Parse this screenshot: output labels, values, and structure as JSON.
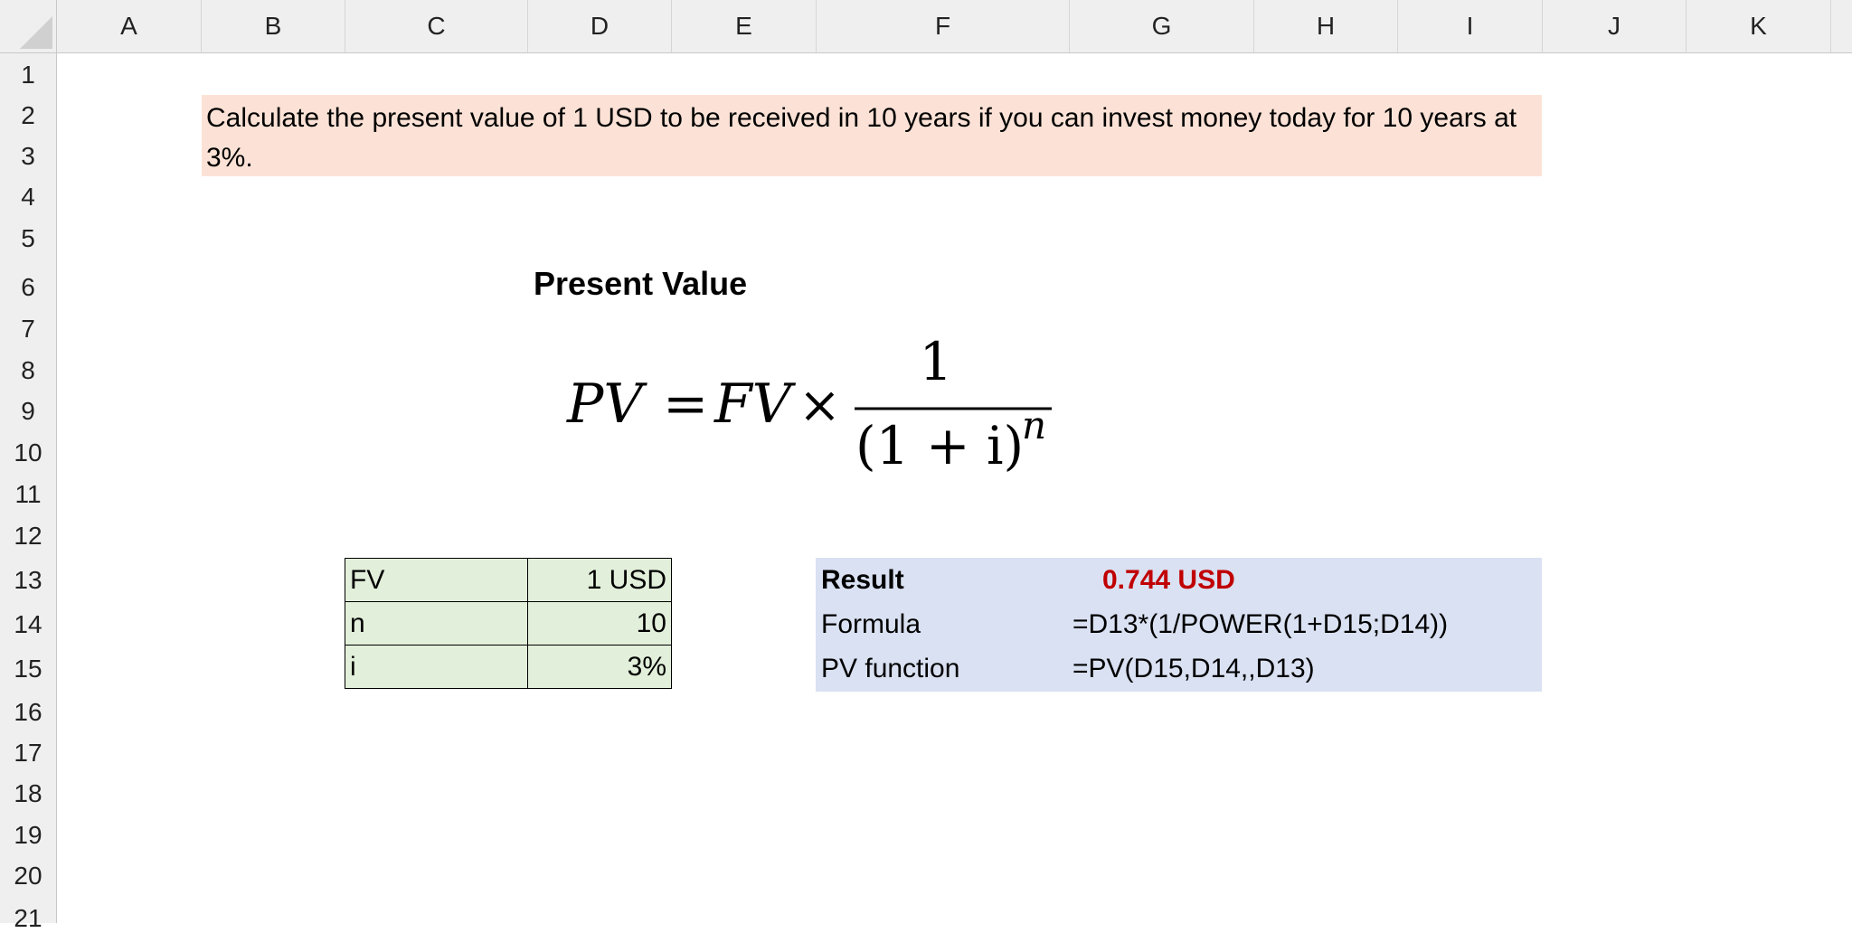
{
  "columns": [
    "A",
    "B",
    "C",
    "D",
    "E",
    "F",
    "G",
    "H",
    "I",
    "J",
    "K"
  ],
  "rows": [
    "1",
    "2",
    "3",
    "4",
    "5",
    "6",
    "7",
    "8",
    "9",
    "10",
    "11",
    "12",
    "13",
    "14",
    "15",
    "16",
    "17",
    "18",
    "19",
    "20",
    "21"
  ],
  "task": "Calculate the present value of 1 USD to be received in 10 years if you can invest money today for 10 years at 3%.",
  "title": "Present Value",
  "formula": {
    "lhs": "PV",
    "equals": "=",
    "fv": "FV",
    "times": "×",
    "numerator": "1",
    "denominator": "(1 + i)",
    "exponent": "n"
  },
  "inputs": [
    {
      "label": "FV",
      "value": "1 USD"
    },
    {
      "label": "n",
      "value": "10"
    },
    {
      "label": "i",
      "value": "3%"
    }
  ],
  "result": {
    "label": "Result",
    "value": "0.744 USD",
    "value_color": "#c00000"
  },
  "formula_row": {
    "label": "Formula",
    "value": "=D13*(1/POWER(1+D15;D14))"
  },
  "pv_function_row": {
    "label": "PV function",
    "value": "=PV(D15,D14,,D13)"
  },
  "colors": {
    "task_bg": "#fce2d6",
    "input_bg": "#e2efda",
    "result_bg": "#d9e1f2",
    "header_bg": "#efefef"
  }
}
